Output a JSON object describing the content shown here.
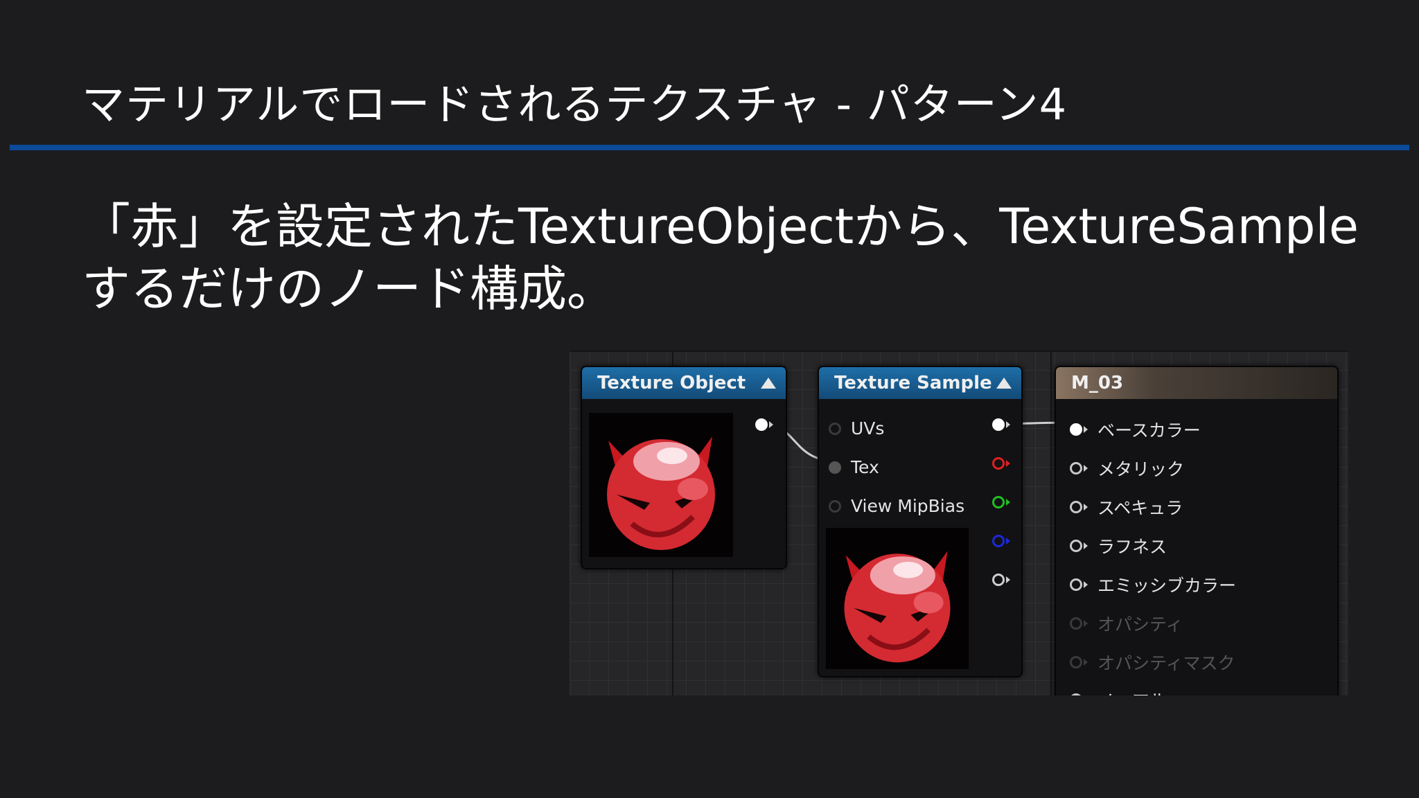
{
  "slide": {
    "title": "マテリアルでロードされるテクスチャ - パターン4",
    "body": "「赤」を設定されたTextureObjectから、TextureSampleするだけのノード構成。"
  },
  "graph": {
    "texture_object": {
      "title": "Texture Object"
    },
    "texture_sample": {
      "title": "Texture Sample",
      "inputs": [
        "UVs",
        "Tex",
        "View MipBias"
      ],
      "output_colors": [
        "#ffffff",
        "#e02020",
        "#20c020",
        "#1a2ad8",
        "#cfcfcf"
      ]
    },
    "result_node": {
      "title": "M_03",
      "inputs": [
        {
          "label": "ベースカラー",
          "enabled": true
        },
        {
          "label": "メタリック",
          "enabled": true
        },
        {
          "label": "スペキュラ",
          "enabled": true
        },
        {
          "label": "ラフネス",
          "enabled": true
        },
        {
          "label": "エミッシブカラー",
          "enabled": true
        },
        {
          "label": "オパシティ",
          "enabled": false
        },
        {
          "label": "オパシティマスク",
          "enabled": false
        },
        {
          "label": "ノーマル",
          "enabled": true
        }
      ]
    },
    "texture_icon": "red-devil-face-icon",
    "accent_color": "#0d4a9a"
  }
}
